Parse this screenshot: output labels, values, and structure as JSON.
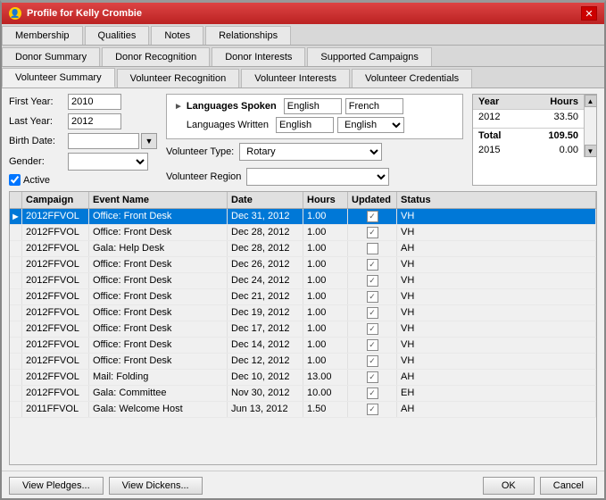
{
  "window": {
    "title": "Profile for Kelly Crombie",
    "close_label": "✕"
  },
  "tabs": {
    "row1": [
      {
        "label": "Membership",
        "active": false
      },
      {
        "label": "Qualities",
        "active": false
      },
      {
        "label": "Notes",
        "active": false
      },
      {
        "label": "Relationships",
        "active": false
      }
    ],
    "row2": [
      {
        "label": "Donor Summary",
        "active": false
      },
      {
        "label": "Donor Recognition",
        "active": false
      },
      {
        "label": "Donor Interests",
        "active": false
      },
      {
        "label": "Supported Campaigns",
        "active": false
      }
    ],
    "row3": [
      {
        "label": "Volunteer Summary",
        "active": true
      },
      {
        "label": "Volunteer Recognition",
        "active": false
      },
      {
        "label": "Volunteer Interests",
        "active": false
      },
      {
        "label": "Volunteer Credentials",
        "active": false
      }
    ]
  },
  "volunteer_summary": {
    "first_year_label": "First Year:",
    "first_year_value": "2010",
    "last_year_label": "Last Year:",
    "last_year_value": "2012",
    "birth_date_label": "Birth Date:",
    "gender_label": "Gender:",
    "active_label": "Active",
    "volunteer_type_label": "Volunteer Type:",
    "volunteer_type_value": "Rotary",
    "volunteer_region_label": "Volunteer Region",
    "languages_spoken_label": "Languages Spoken",
    "languages_written_label": "Languages Written",
    "lang_spoken_1": "English",
    "lang_spoken_2": "French",
    "lang_written_1": "English",
    "lang_written_2": "English"
  },
  "year_hours_table": {
    "col_year": "Year",
    "col_hours": "Hours",
    "total_label": "Total",
    "total_value": "109.50",
    "rows": [
      {
        "year": "2012",
        "hours": "33.50"
      },
      {
        "year": "",
        "hours": ""
      },
      {
        "year": "2015",
        "hours": "0.00"
      }
    ]
  },
  "main_table": {
    "columns": [
      "",
      "Campaign",
      "Event Name",
      "Date",
      "Hours",
      "Updated",
      "Status"
    ],
    "rows": [
      {
        "arrow": true,
        "campaign": "2012FFVOL",
        "event": "Office: Front Desk",
        "date": "Dec 31, 2012",
        "hours": "1.00",
        "updated": true,
        "status": "VH",
        "selected": true
      },
      {
        "arrow": false,
        "campaign": "2012FFVOL",
        "event": "Office: Front Desk",
        "date": "Dec 28, 2012",
        "hours": "1.00",
        "updated": true,
        "status": "VH",
        "selected": false
      },
      {
        "arrow": false,
        "campaign": "2012FFVOL",
        "event": "Gala: Help Desk",
        "date": "Dec 28, 2012",
        "hours": "1.00",
        "updated": false,
        "status": "AH",
        "selected": false
      },
      {
        "arrow": false,
        "campaign": "2012FFVOL",
        "event": "Office: Front Desk",
        "date": "Dec 26, 2012",
        "hours": "1.00",
        "updated": true,
        "status": "VH",
        "selected": false
      },
      {
        "arrow": false,
        "campaign": "2012FFVOL",
        "event": "Office: Front Desk",
        "date": "Dec 24, 2012",
        "hours": "1.00",
        "updated": true,
        "status": "VH",
        "selected": false
      },
      {
        "arrow": false,
        "campaign": "2012FFVOL",
        "event": "Office: Front Desk",
        "date": "Dec 21, 2012",
        "hours": "1.00",
        "updated": true,
        "status": "VH",
        "selected": false
      },
      {
        "arrow": false,
        "campaign": "2012FFVOL",
        "event": "Office: Front Desk",
        "date": "Dec 19, 2012",
        "hours": "1.00",
        "updated": true,
        "status": "VH",
        "selected": false
      },
      {
        "arrow": false,
        "campaign": "2012FFVOL",
        "event": "Office: Front Desk",
        "date": "Dec 17, 2012",
        "hours": "1.00",
        "updated": true,
        "status": "VH",
        "selected": false
      },
      {
        "arrow": false,
        "campaign": "2012FFVOL",
        "event": "Office: Front Desk",
        "date": "Dec 14, 2012",
        "hours": "1.00",
        "updated": true,
        "status": "VH",
        "selected": false
      },
      {
        "arrow": false,
        "campaign": "2012FFVOL",
        "event": "Office: Front Desk",
        "date": "Dec 12, 2012",
        "hours": "1.00",
        "updated": true,
        "status": "VH",
        "selected": false
      },
      {
        "arrow": false,
        "campaign": "2012FFVOL",
        "event": "Mail: Folding",
        "date": "Dec 10, 2012",
        "hours": "13.00",
        "updated": true,
        "status": "AH",
        "selected": false
      },
      {
        "arrow": false,
        "campaign": "2012FFVOL",
        "event": "Gala: Committee",
        "date": "Nov 30, 2012",
        "hours": "10.00",
        "updated": true,
        "status": "EH",
        "selected": false
      },
      {
        "arrow": false,
        "campaign": "2011FFVOL",
        "event": "Gala: Welcome Host",
        "date": "Jun 13, 2012",
        "hours": "1.50",
        "updated": true,
        "status": "AH",
        "selected": false
      }
    ]
  },
  "buttons": {
    "view_pledges": "View Pledges...",
    "view_dickens": "View Dickens...",
    "ok": "OK",
    "cancel": "Cancel"
  }
}
